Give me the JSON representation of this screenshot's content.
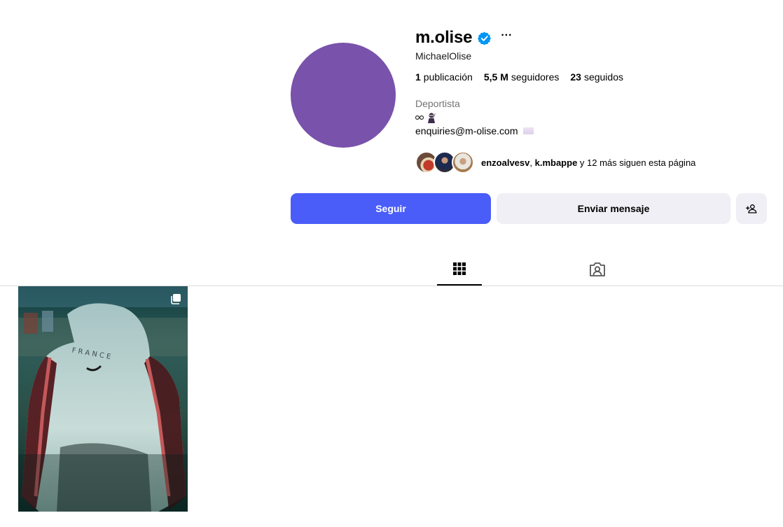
{
  "profile": {
    "username": "m.olise",
    "full_name": "MichaelOlise",
    "avatar_color": "#7952ab",
    "verified_icon": "verified-badge-icon",
    "more_label": "···"
  },
  "stats": {
    "posts_count": "1",
    "posts_label": "publicación",
    "followers_count": "5,5 M",
    "followers_label": "seguidores",
    "following_count": "23",
    "following_label": "seguidos"
  },
  "bio": {
    "category": "Deportista",
    "line1_icons": [
      "infinity-icon",
      "ninja-emoji-icon"
    ],
    "email": "enquiries@m-olise.com",
    "email_trailing_icon": "envelope-emoji-icon"
  },
  "followed_by": {
    "user1": "enzoalvesv",
    "separator": ", ",
    "user2": "k.mbappe",
    "rest": " y 12 más siguen esta página"
  },
  "actions": {
    "follow": "Seguir",
    "message": "Enviar mensaje",
    "suggest_icon": "add-person-icon"
  },
  "tabs": [
    {
      "name": "posts",
      "icon": "grid-icon",
      "active": true
    },
    {
      "name": "tagged",
      "icon": "tagged-person-icon",
      "active": false
    }
  ],
  "posts": [
    {
      "type": "carousel",
      "icon": "multiple-images-icon"
    }
  ],
  "colors": {
    "primary_button": "#4a5df9",
    "secondary_button": "#efeff5",
    "verified": "#0095f6"
  }
}
